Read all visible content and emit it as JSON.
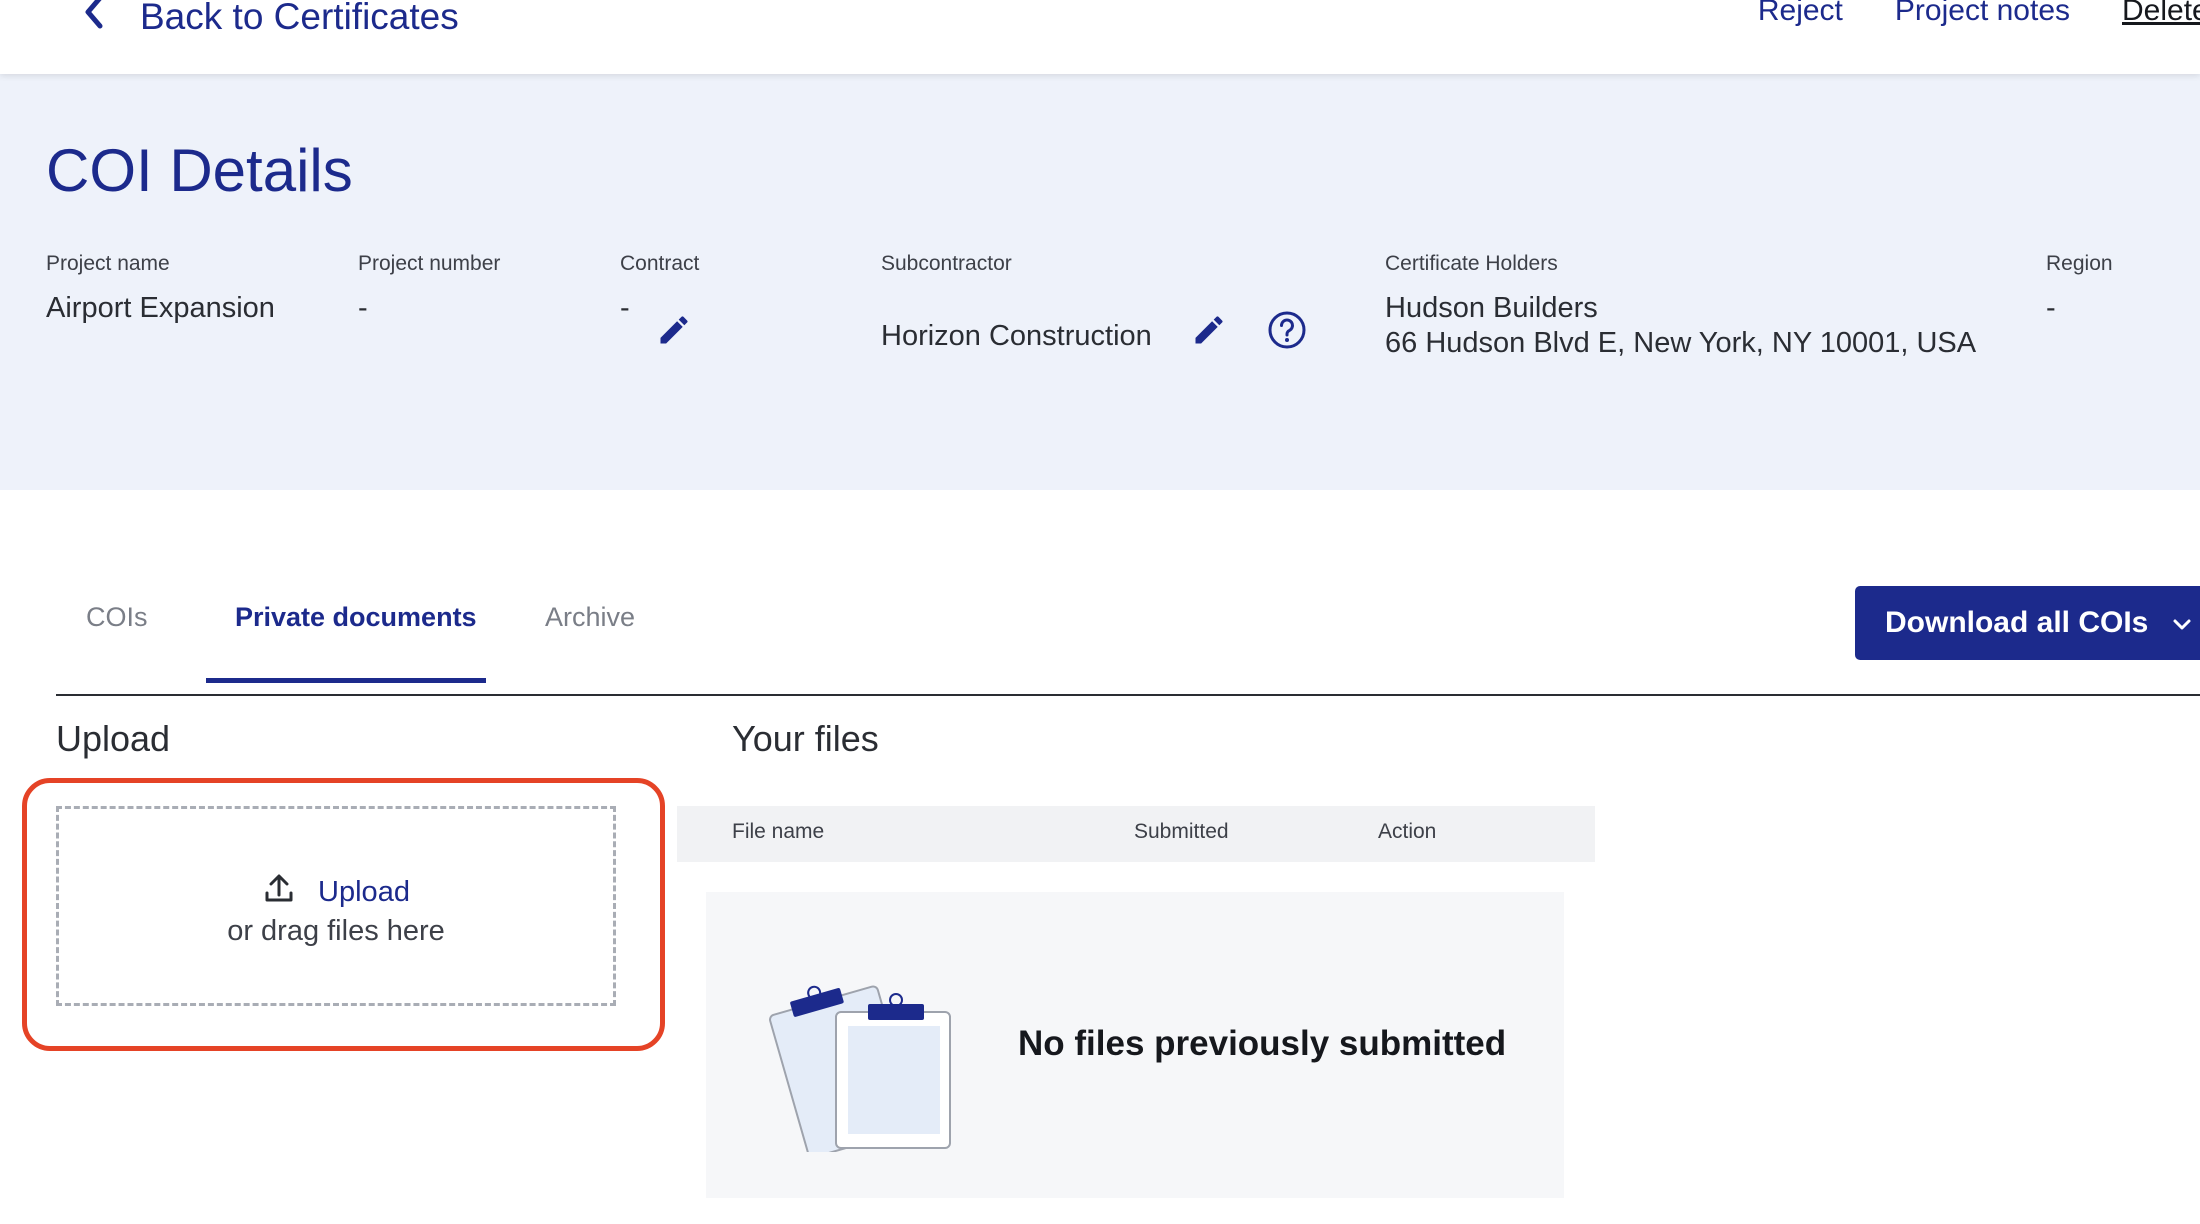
{
  "topbar": {
    "back_label": "Back to Certificates",
    "actions": {
      "reject": "Reject",
      "project_notes": "Project notes",
      "delete": "Delete"
    }
  },
  "header": {
    "title": "COI Details",
    "fields": {
      "project_name": {
        "label": "Project name",
        "value": "Airport Expansion"
      },
      "project_number": {
        "label": "Project number",
        "value": "-"
      },
      "contract": {
        "label": "Contract",
        "value": "-"
      },
      "subcontractor": {
        "label": "Subcontractor",
        "value": "Horizon Construction"
      },
      "certificate_holders": {
        "label": "Certificate Holders",
        "name": "Hudson Builders",
        "address": "66 Hudson Blvd E, New York, NY 10001, USA"
      },
      "region": {
        "label": "Region",
        "value": "-"
      }
    }
  },
  "tabs": {
    "items": [
      "COIs",
      "Private documents",
      "Archive"
    ],
    "active": "Private documents"
  },
  "download_button": {
    "label": "Download all COIs"
  },
  "upload": {
    "title": "Upload",
    "link_label": "Upload",
    "hint": "or drag files here"
  },
  "files": {
    "title": "Your files",
    "columns": [
      "File name",
      "Submitted",
      "Action"
    ],
    "empty_message": "No files previously submitted"
  },
  "colors": {
    "brand": "#1c2a8c",
    "highlight": "#e54326",
    "band": "#eef2fa"
  }
}
